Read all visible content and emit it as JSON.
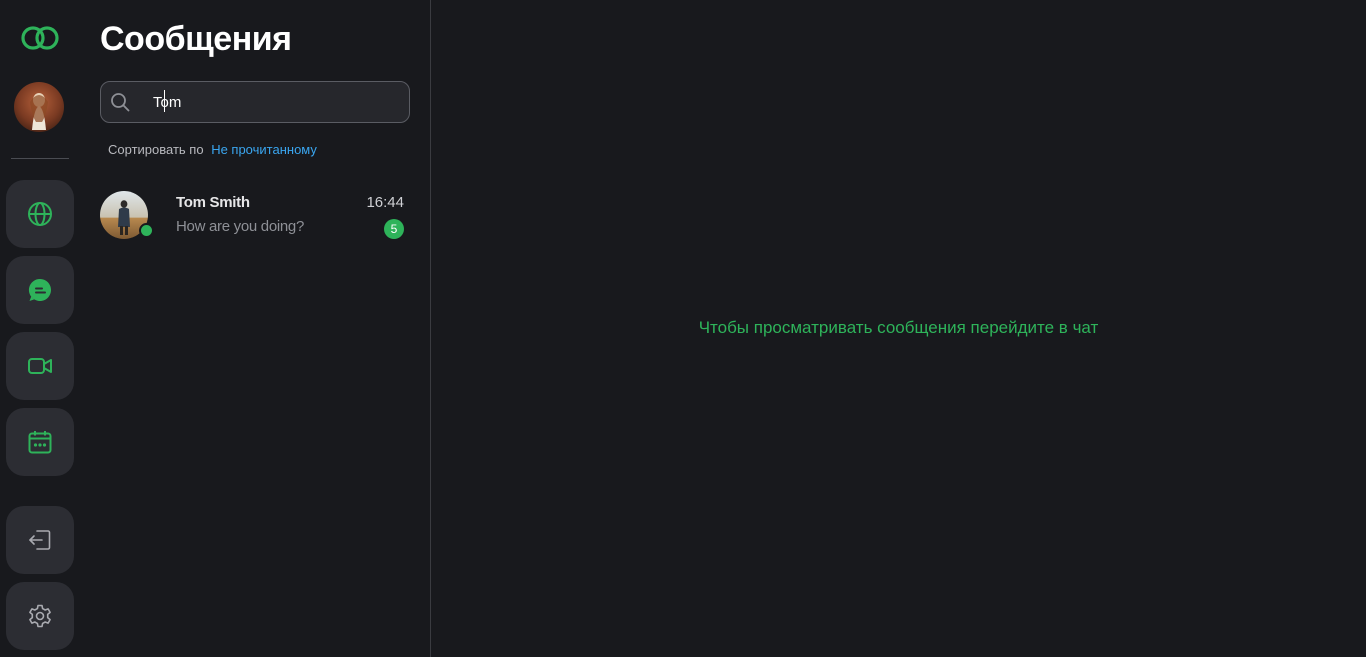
{
  "colors": {
    "background": "#18191d",
    "accent_green": "#2eb35a",
    "link_blue": "#3aa6f0",
    "rail_button": "#2c2d33"
  },
  "rail": {
    "logo_icon": "linked-rings-logo",
    "items": [
      {
        "name": "globe",
        "icon": "globe-icon"
      },
      {
        "name": "chats",
        "icon": "chat-bubble-icon"
      },
      {
        "name": "video",
        "icon": "video-camera-icon"
      },
      {
        "name": "calendar",
        "icon": "calendar-icon"
      },
      {
        "name": "logout",
        "icon": "logout-icon"
      },
      {
        "name": "settings",
        "icon": "gear-icon"
      }
    ]
  },
  "panel": {
    "title": "Сообщения",
    "search": {
      "value": "Tom",
      "placeholder": ""
    },
    "sort": {
      "label": "Сортировать по",
      "value": "Не прочитанному"
    },
    "chats": [
      {
        "name": "Tom Smith",
        "time": "16:44",
        "preview": "How are you doing?",
        "unread": "5",
        "online": true
      }
    ]
  },
  "main": {
    "empty_text": "Чтобы просматривать сообщения перейдите в чат"
  }
}
